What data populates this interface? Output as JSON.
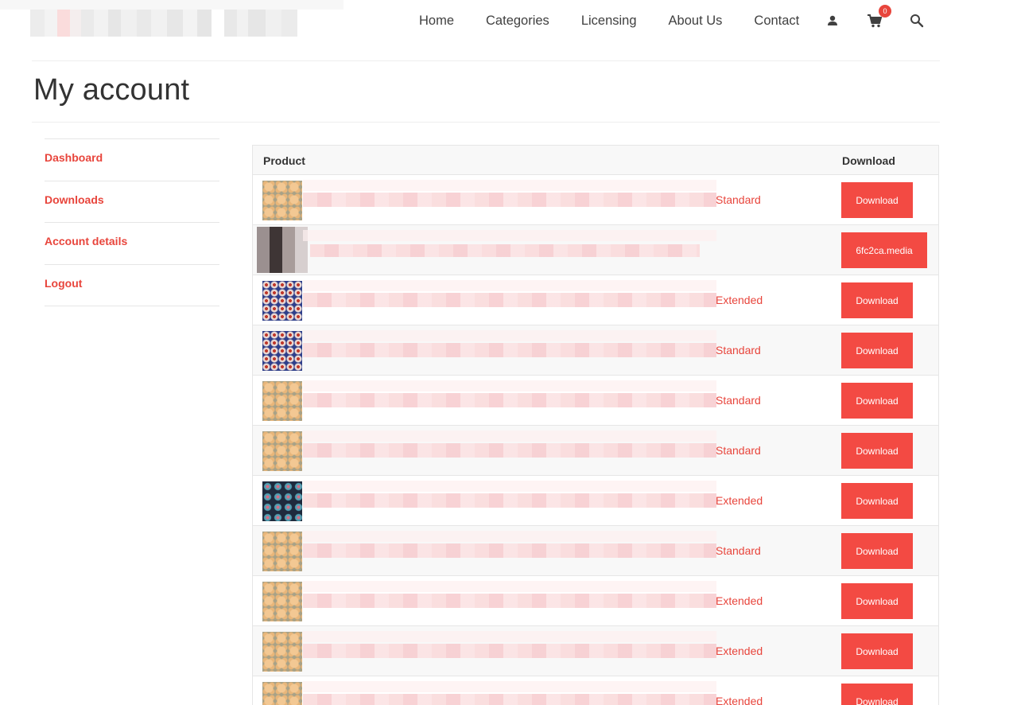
{
  "header": {
    "nav": [
      "Home",
      "Categories",
      "Licensing",
      "About Us",
      "Contact"
    ],
    "cart_count": "0",
    "icons": [
      "user-icon",
      "cart-icon",
      "search-icon"
    ]
  },
  "page": {
    "title": "My account"
  },
  "sidebar": {
    "items": [
      "Dashboard",
      "Downloads",
      "Account details",
      "Logout"
    ]
  },
  "table": {
    "headers": {
      "product": "Product",
      "download": "Download"
    },
    "rows": [
      {
        "thumb": "beige-floral",
        "license": "Standard",
        "button": "Download"
      },
      {
        "thumb": "blurred",
        "license": "",
        "button": "6fc2ca.media"
      },
      {
        "thumb": "blue-floral",
        "license": "Extended",
        "button": "Download"
      },
      {
        "thumb": "blue-floral",
        "license": "Standard",
        "button": "Download"
      },
      {
        "thumb": "beige-floral",
        "license": "Standard",
        "button": "Download"
      },
      {
        "thumb": "beige-floral",
        "license": "Standard",
        "button": "Download"
      },
      {
        "thumb": "navy-floral",
        "license": "Extended",
        "button": "Download"
      },
      {
        "thumb": "beige-floral",
        "license": "Standard",
        "button": "Download"
      },
      {
        "thumb": "beige-floral",
        "license": "Extended",
        "button": "Download"
      },
      {
        "thumb": "beige-floral",
        "license": "Extended",
        "button": "Download"
      },
      {
        "thumb": "beige-floral",
        "license": "Extended",
        "button": "Download"
      }
    ]
  },
  "colors": {
    "accent": "#e8453c",
    "button": "#f34a43",
    "border": "#e6e6e6",
    "row_alt": "#f8f8f8"
  }
}
